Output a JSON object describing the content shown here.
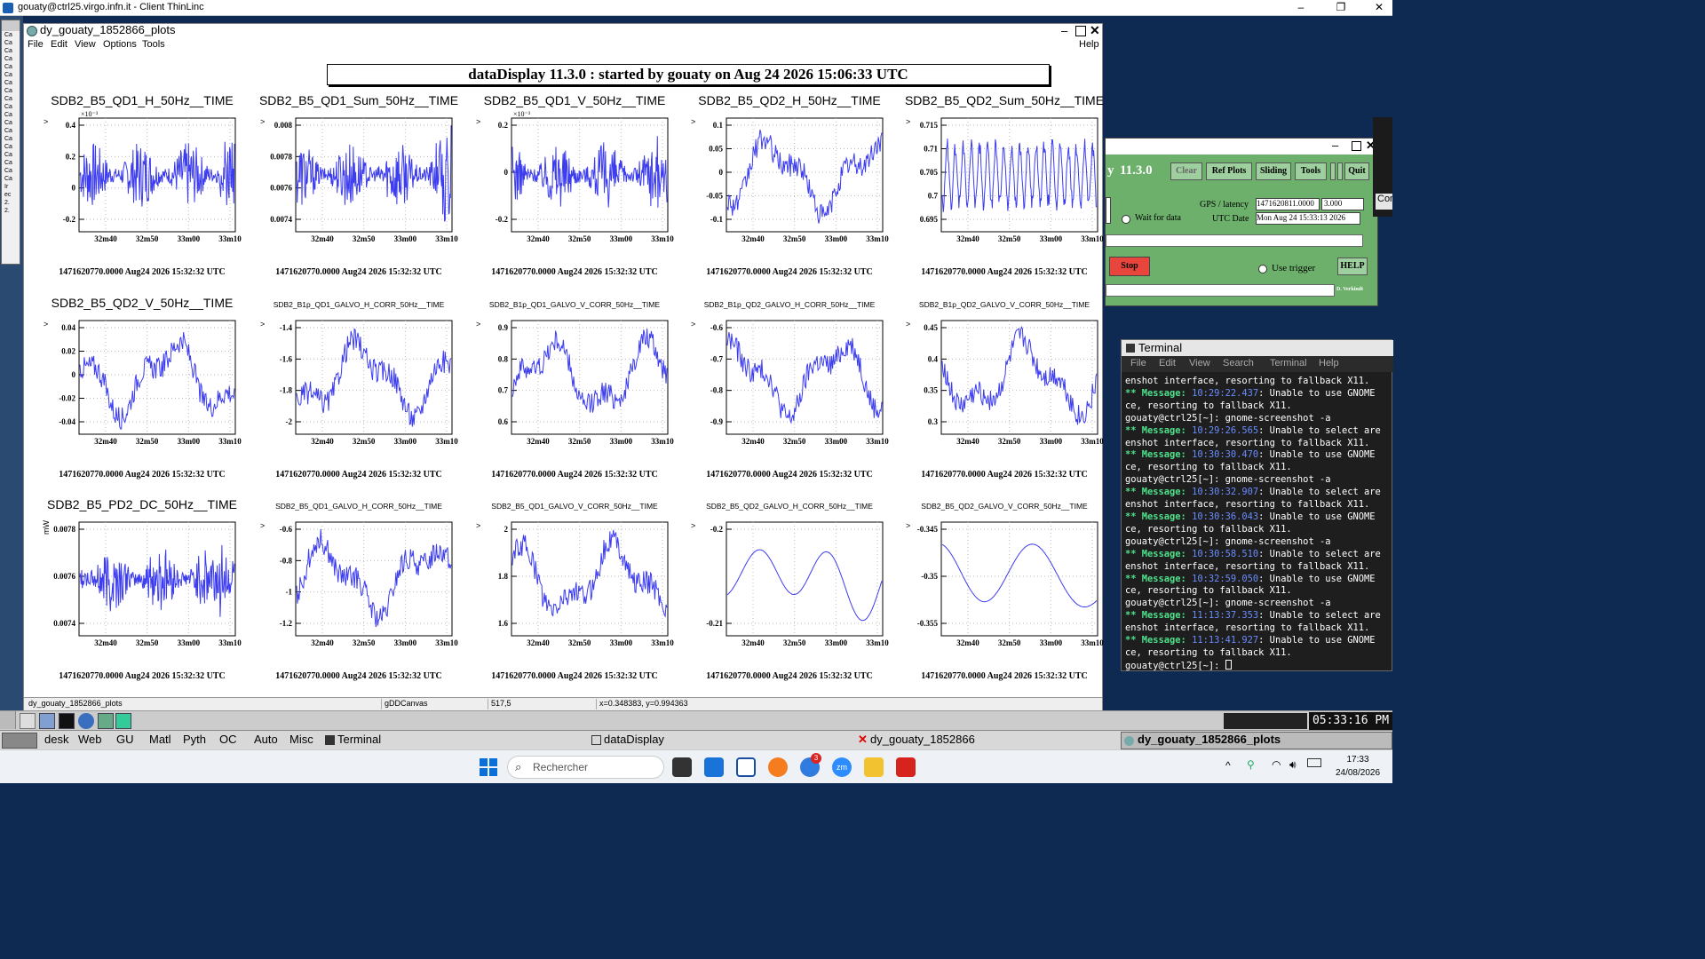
{
  "thinlinc": {
    "title": "gouaty@ctrl25.virgo.infn.it - Client ThinLinc",
    "min": "–",
    "max": "❐",
    "close": "✕"
  },
  "window": {
    "title": "dy_gouaty_1852866_plots",
    "menus": [
      "File",
      "Edit",
      "View",
      "Options",
      "Tools"
    ],
    "help": "Help"
  },
  "banner": "dataDisplay 11.3.0 : started by gouaty on Aug 24 2026 15:06:33 UTC",
  "footer": "1471620770.0000 Aug24 2026 15:32:32 UTC",
  "xticks": [
    "32m40",
    "32m50",
    "33m00",
    "33m10"
  ],
  "plots": [
    {
      "title": "SDB2_B5_QD1_H_50Hz__TIME",
      "small": false,
      "ylabel": ">",
      "exp": "×10⁻³",
      "yticks": [
        "0.4",
        "0.2",
        "0",
        "-0.2"
      ],
      "style": "noise"
    },
    {
      "title": "SDB2_B5_QD1_Sum_50Hz__TIME",
      "small": false,
      "ylabel": ">",
      "exp": "",
      "yticks": [
        "0.008",
        "0.0078",
        "0.0076",
        "0.0074"
      ],
      "style": "noise"
    },
    {
      "title": "SDB2_B5_QD1_V_50Hz__TIME",
      "small": false,
      "ylabel": ">",
      "exp": "×10⁻³",
      "yticks": [
        "0.2",
        "0",
        "-0.2"
      ],
      "style": "noise"
    },
    {
      "title": "SDB2_B5_QD2_H_50Hz__TIME",
      "small": false,
      "ylabel": ">",
      "exp": "",
      "yticks": [
        "0.1",
        "0.05",
        "0",
        "-0.05",
        "-0.1"
      ],
      "style": "wave"
    },
    {
      "title": "SDB2_B5_QD2_Sum_50Hz__TIME",
      "small": false,
      "ylabel": ">",
      "exp": "",
      "yticks": [
        "0.715",
        "0.71",
        "0.705",
        "0.7",
        "0.695"
      ],
      "style": "osc"
    },
    {
      "title": "SDB2_B5_QD2_V_50Hz__TIME",
      "small": false,
      "ylabel": ">",
      "exp": "",
      "yticks": [
        "0.04",
        "0.02",
        "0",
        "-0.02",
        "-0.04"
      ],
      "style": "wave"
    },
    {
      "title": "SDB2_B1p_QD1_GALVO_H_CORR_50Hz__TIME",
      "small": true,
      "ylabel": ">",
      "exp": "",
      "yticks": [
        "-1.4",
        "-1.6",
        "-1.8",
        "-2"
      ],
      "style": "wave"
    },
    {
      "title": "SDB2_B1p_QD1_GALVO_V_CORR_50Hz__TIME",
      "small": true,
      "ylabel": ">",
      "exp": "",
      "yticks": [
        "0.9",
        "0.8",
        "0.7",
        "0.6"
      ],
      "style": "wave"
    },
    {
      "title": "SDB2_B1p_QD2_GALVO_H_CORR_50Hz__TIME",
      "small": true,
      "ylabel": ">",
      "exp": "",
      "yticks": [
        "-0.6",
        "-0.7",
        "-0.8",
        "-0.9"
      ],
      "style": "wave"
    },
    {
      "title": "SDB2_B1p_QD2_GALVO_V_CORR_50Hz__TIME",
      "small": true,
      "ylabel": ">",
      "exp": "",
      "yticks": [
        "0.45",
        "0.4",
        "0.35",
        "0.3"
      ],
      "style": "wave"
    },
    {
      "title": "SDB2_B5_PD2_DC_50Hz__TIME",
      "small": false,
      "ylabel": "mW",
      "exp": "",
      "yticks": [
        "0.0078",
        "0.0076",
        "0.0074"
      ],
      "style": "noise"
    },
    {
      "title": "SDB2_B5_QD1_GALVO_H_CORR_50Hz__TIME",
      "small": true,
      "ylabel": ">",
      "exp": "",
      "yticks": [
        "-0.6",
        "-0.8",
        "-1",
        "-1.2"
      ],
      "style": "wave"
    },
    {
      "title": "SDB2_B5_QD1_GALVO_V_CORR_50Hz__TIME",
      "small": true,
      "ylabel": ">",
      "exp": "",
      "yticks": [
        "2",
        "1.8",
        "1.6"
      ],
      "style": "wave"
    },
    {
      "title": "SDB2_B5_QD2_GALVO_H_CORR_50Hz__TIME",
      "small": true,
      "ylabel": ">",
      "exp": "",
      "yticks": [
        "-0.2",
        "-0.21"
      ],
      "style": "smooth"
    },
    {
      "title": "SDB2_B5_QD2_GALVO_V_CORR_50Hz__TIME",
      "small": true,
      "ylabel": ">",
      "exp": "",
      "yticks": [
        "-0.345",
        "-0.35",
        "-0.355"
      ],
      "style": "smooth2"
    }
  ],
  "status": {
    "name": "dy_gouaty_1852866_plots",
    "canvas": "gDDCanvas",
    "pos": "517,5",
    "coords": "x=0.348383, y=0.994363"
  },
  "control": {
    "version": "11.3.0",
    "clear": "Clear",
    "refplots": "Ref Plots",
    "sliding": "Sliding",
    "tools": "Tools",
    "quit": "Quit",
    "gps_label": "GPS / latency",
    "gps_value": "1471620811.0000",
    "latency": "3.000",
    "wait": "Wait for data",
    "utc_label": "UTC Date",
    "utc_value": "Mon Aug 24 15:33:13 2026",
    "stop": "Stop",
    "use_trigger": "Use trigger",
    "help": "HELP",
    "credit": "D. Verkindt",
    "con": "Con"
  },
  "terminal": {
    "title": "Terminal",
    "menus": [
      "File",
      "Edit",
      "View",
      "Search",
      "Terminal",
      "Help"
    ],
    "lines": [
      [
        "",
        "enshot interface, resorting to fallback X11."
      ],
      [
        "msg",
        "10:29:22.437",
        ": Unable to use GNOME"
      ],
      [
        "",
        "ce, resorting to fallback X11."
      ],
      [
        "",
        "gouaty@ctrl25[~]: gnome-screenshot -a"
      ],
      [
        "msg",
        "10:29:26.565",
        ": Unable to select are"
      ],
      [
        "",
        "enshot interface, resorting to fallback X11."
      ],
      [
        "msg",
        "10:30:30.470",
        ": Unable to use GNOME"
      ],
      [
        "",
        "ce, resorting to fallback X11."
      ],
      [
        "",
        "gouaty@ctrl25[~]: gnome-screenshot -a"
      ],
      [
        "msg",
        "10:30:32.907",
        ": Unable to select are"
      ],
      [
        "",
        "enshot interface, resorting to fallback X11."
      ],
      [
        "msg",
        "10:30:36.043",
        ": Unable to use GNOME"
      ],
      [
        "",
        "ce, resorting to fallback X11."
      ],
      [
        "",
        "gouaty@ctrl25[~]: gnome-screenshot -a"
      ],
      [
        "msg",
        "10:30:58.510",
        ": Unable to select are"
      ],
      [
        "",
        "enshot interface, resorting to fallback X11."
      ],
      [
        "msg",
        "10:32:59.050",
        ": Unable to use GNOME"
      ],
      [
        "",
        "ce, resorting to fallback X11."
      ],
      [
        "",
        "gouaty@ctrl25[~]: gnome-screenshot -a"
      ],
      [
        "msg",
        "11:13:37.353",
        ": Unable to select are"
      ],
      [
        "",
        "enshot interface, resorting to fallback X11."
      ],
      [
        "msg",
        "11:13:41.927",
        ": Unable to use GNOME"
      ],
      [
        "",
        "ce, resorting to fallback X11."
      ],
      [
        "",
        "gouaty@ctrl25[~]: "
      ]
    ],
    "msg_word": "** Message:"
  },
  "panel": {
    "clock": "05:33:16 PM"
  },
  "taskbar": {
    "items": [
      "desk",
      "Web",
      "GU",
      "Matl",
      "Pyth",
      "OC",
      "Auto",
      "Misc"
    ],
    "terminal": "Terminal",
    "datadisplay": "dataDisplay",
    "dy": "dy_gouaty_1852866",
    "dyplots": "dy_gouaty_1852866_plots"
  },
  "windows": {
    "search": "Rechercher",
    "time": "17:33",
    "date": "24/08/2026",
    "badge": "3"
  },
  "colors": {
    "line": "#3c3cf0",
    "ctrl": "#6cb06c",
    "stop": "#e8453c"
  }
}
